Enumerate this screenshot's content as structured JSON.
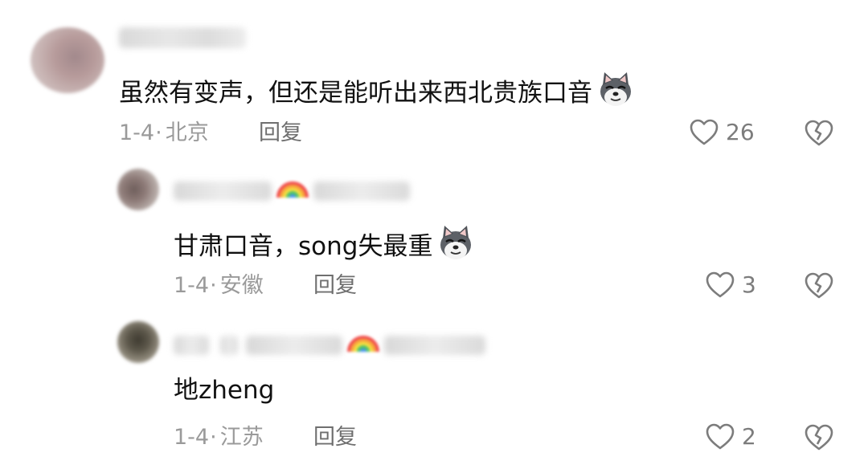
{
  "comments": [
    {
      "text": "虽然有变声，但还是能听出来西北贵族口音",
      "emoji": "wolf-face-emoji",
      "date": "1-4",
      "location": "北京",
      "reply_label": "回复",
      "likes": "26"
    },
    {
      "text": "甘肃口音，song失最重",
      "emoji": "wolf-face-emoji",
      "date": "1-4",
      "location": "安徽",
      "reply_label": "回复",
      "likes": "3"
    },
    {
      "text": "地zheng",
      "date": "1-4",
      "location": "江苏",
      "reply_label": "回复",
      "likes": "2"
    }
  ],
  "separator": "·",
  "colors": {
    "text": "#111111",
    "meta": "#9a9a9a",
    "icon": "#7c7c7c"
  }
}
